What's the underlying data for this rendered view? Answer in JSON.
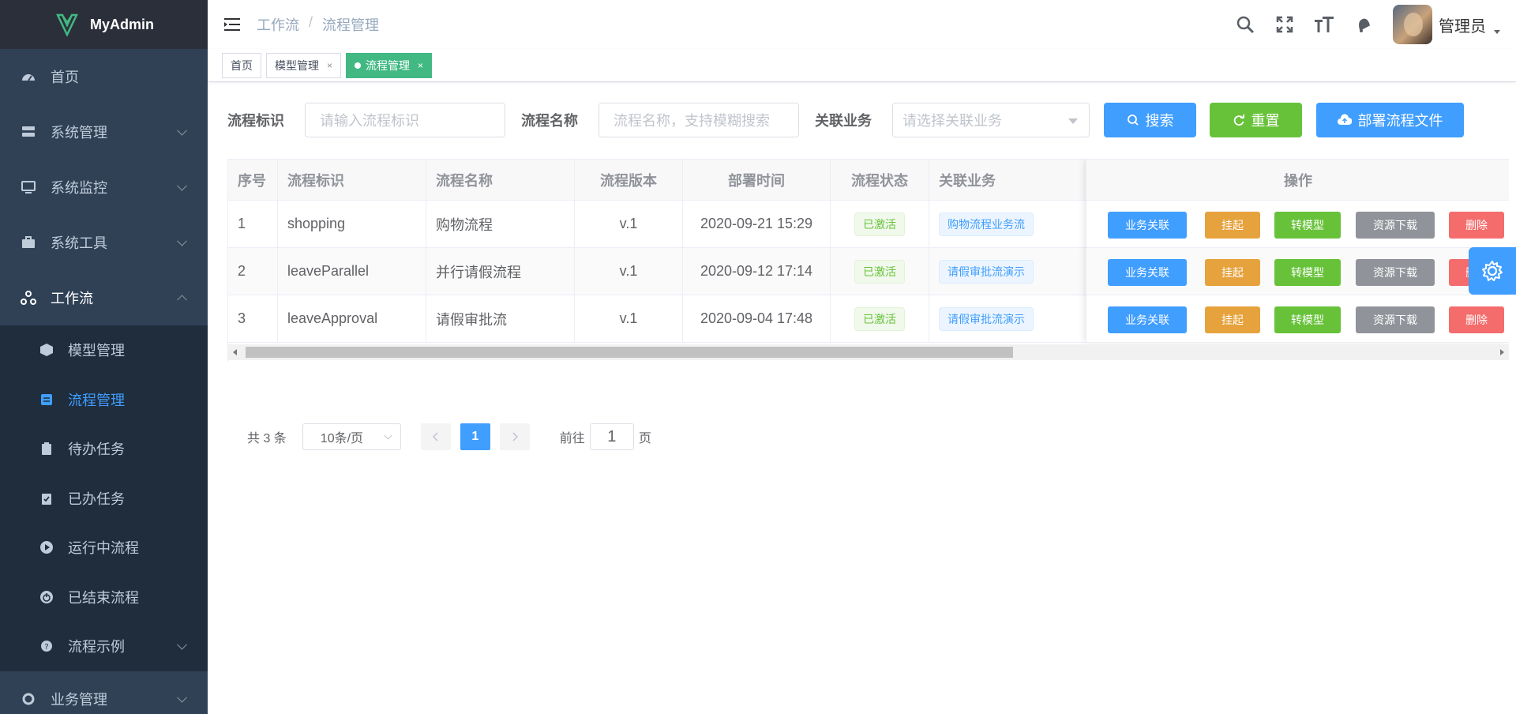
{
  "app": {
    "name": "MyAdmin"
  },
  "colors": {
    "sidebar_bg": "#304156",
    "primary": "#409eff",
    "success": "#67c23a",
    "warning": "#e6a23c",
    "info": "#909399",
    "danger": "#f56c6c",
    "tag_active": "#42b983"
  },
  "sidebar": {
    "items": [
      {
        "label": "首页",
        "icon": "dashboard-icon"
      },
      {
        "label": "系统管理",
        "icon": "system-icon"
      },
      {
        "label": "系统监控",
        "icon": "monitor-icon"
      },
      {
        "label": "系统工具",
        "icon": "toolbox-icon"
      },
      {
        "label": "工作流",
        "icon": "workflow-icon"
      }
    ],
    "workflow_sub": [
      {
        "label": "模型管理",
        "icon": "cube-icon"
      },
      {
        "label": "流程管理",
        "icon": "process-icon"
      },
      {
        "label": "待办任务",
        "icon": "clipboard-icon"
      },
      {
        "label": "已办任务",
        "icon": "clipboard-check-icon"
      },
      {
        "label": "运行中流程",
        "icon": "play-icon"
      },
      {
        "label": "已结束流程",
        "icon": "power-icon"
      },
      {
        "label": "流程示例",
        "icon": "help-icon"
      }
    ],
    "business": {
      "label": "业务管理",
      "icon": "business-icon"
    }
  },
  "header": {
    "breadcrumb": [
      "工作流",
      "流程管理"
    ],
    "breadcrumb_sep": "/",
    "username": "管理员"
  },
  "tags": [
    {
      "label": "首页"
    },
    {
      "label": "模型管理",
      "close": "×"
    },
    {
      "label": "流程管理",
      "close": "×"
    }
  ],
  "search": {
    "key_label": "流程标识",
    "key_placeholder": "请输入流程标识",
    "name_label": "流程名称",
    "name_placeholder": "流程名称，支持模糊搜索",
    "biz_label": "关联业务",
    "biz_placeholder": "请选择关联业务",
    "search_btn": "搜索",
    "reset_btn": "重置",
    "deploy_btn": "部署流程文件"
  },
  "table": {
    "headers": [
      "序号",
      "流程标识",
      "流程名称",
      "流程版本",
      "部署时间",
      "流程状态",
      "关联业务",
      "操作"
    ],
    "rows": [
      {
        "no": "1",
        "key": "shopping",
        "name": "购物流程",
        "version": "v.1",
        "time": "2020-09-21 15:29",
        "status": "已激活",
        "biz": "购物流程业务流"
      },
      {
        "no": "2",
        "key": "leaveParallel",
        "name": "并行请假流程",
        "version": "v.1",
        "time": "2020-09-12 17:14",
        "status": "已激活",
        "biz": "请假审批流演示"
      },
      {
        "no": "3",
        "key": "leaveApproval",
        "name": "请假审批流",
        "version": "v.1",
        "time": "2020-09-04 17:48",
        "status": "已激活",
        "biz": "请假审批流演示"
      }
    ],
    "ops": [
      "业务关联",
      "挂起",
      "转模型",
      "资源下载",
      "删除"
    ]
  },
  "pagination": {
    "total": "共 3 条",
    "page_size": "10条/页",
    "current": "1",
    "goto_prefix": "前往",
    "goto_value": "1",
    "goto_suffix": "页"
  }
}
